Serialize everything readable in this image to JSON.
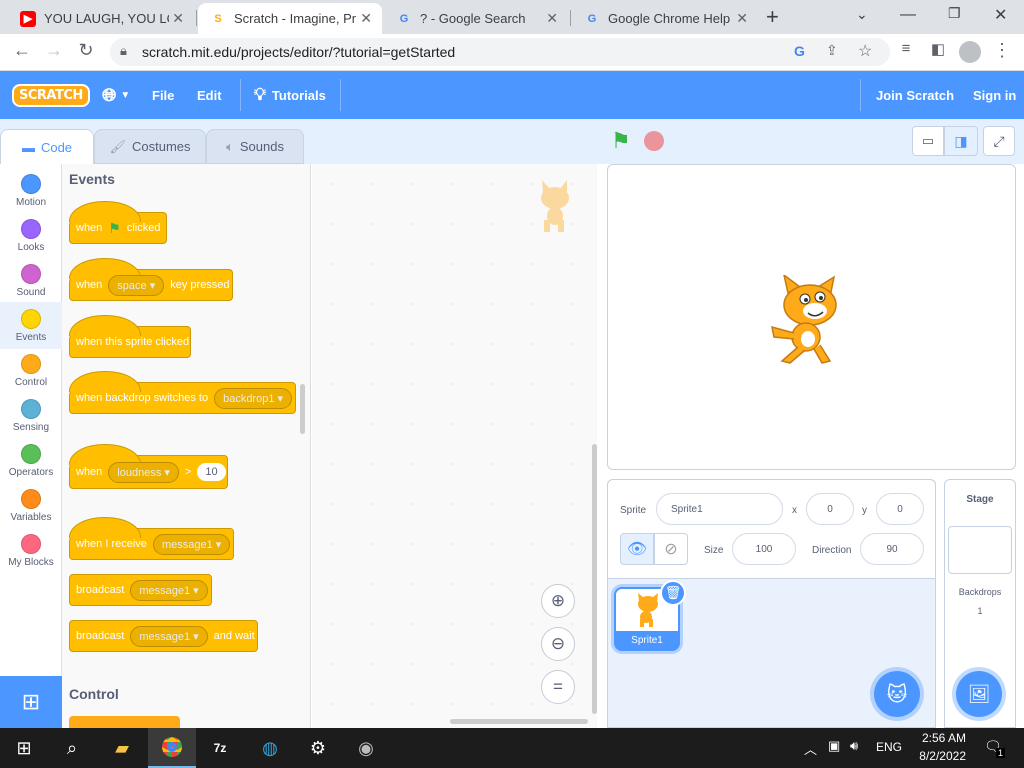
{
  "browser": {
    "tabs": [
      {
        "title": "YOU LAUGH, YOU LOSE",
        "icon": "youtube-icon"
      },
      {
        "title": "Scratch - Imagine, Prog",
        "icon": "scratch-icon"
      },
      {
        "title": "? - Google Search",
        "icon": "google-icon"
      },
      {
        "title": "Google Chrome Help",
        "icon": "google-icon"
      }
    ],
    "new_tab": "+",
    "url": "scratch.mit.edu/projects/editor/?tutorial=getStarted"
  },
  "menubar": {
    "file": "File",
    "edit": "Edit",
    "tutorials": "Tutorials",
    "join": "Join Scratch",
    "signin": "Sign in"
  },
  "editor_tabs": {
    "code": "Code",
    "costumes": "Costumes",
    "sounds": "Sounds"
  },
  "categories": [
    {
      "label": "Motion",
      "color": "#4c97ff"
    },
    {
      "label": "Looks",
      "color": "#9966ff"
    },
    {
      "label": "Sound",
      "color": "#cf63cf"
    },
    {
      "label": "Events",
      "color": "#ffd500"
    },
    {
      "label": "Control",
      "color": "#ffab19"
    },
    {
      "label": "Sensing",
      "color": "#5cb1d6"
    },
    {
      "label": "Operators",
      "color": "#59c059"
    },
    {
      "label": "Variables",
      "color": "#ff8c1a"
    },
    {
      "label": "My Blocks",
      "color": "#ff6680"
    }
  ],
  "palette": {
    "events_title": "Events",
    "control_title": "Control",
    "blocks": {
      "when": "when",
      "clicked": "clicked",
      "space": "space",
      "key_pressed": "key pressed",
      "sprite_clicked": "when this sprite clicked",
      "backdrop_switches": "when backdrop switches to",
      "backdrop1": "backdrop1",
      "loudness": "loudness",
      "gt": ">",
      "ten": "10",
      "receive": "when I receive",
      "message1": "message1",
      "broadcast": "broadcast",
      "and_wait": "and wait"
    }
  },
  "sprite_info": {
    "sprite_label": "Sprite",
    "sprite_name": "Sprite1",
    "x_label": "x",
    "x": "0",
    "y_label": "y",
    "y": "0",
    "size_label": "Size",
    "size": "100",
    "direction_label": "Direction",
    "direction": "90",
    "thumb_name": "Sprite1"
  },
  "stage_pane": {
    "title": "Stage",
    "backdrops_label": "Backdrops",
    "backdrops_count": "1"
  },
  "taskbar": {
    "lang": "ENG",
    "time": "2:56 AM",
    "date": "8/2/2022",
    "notif": "1"
  }
}
